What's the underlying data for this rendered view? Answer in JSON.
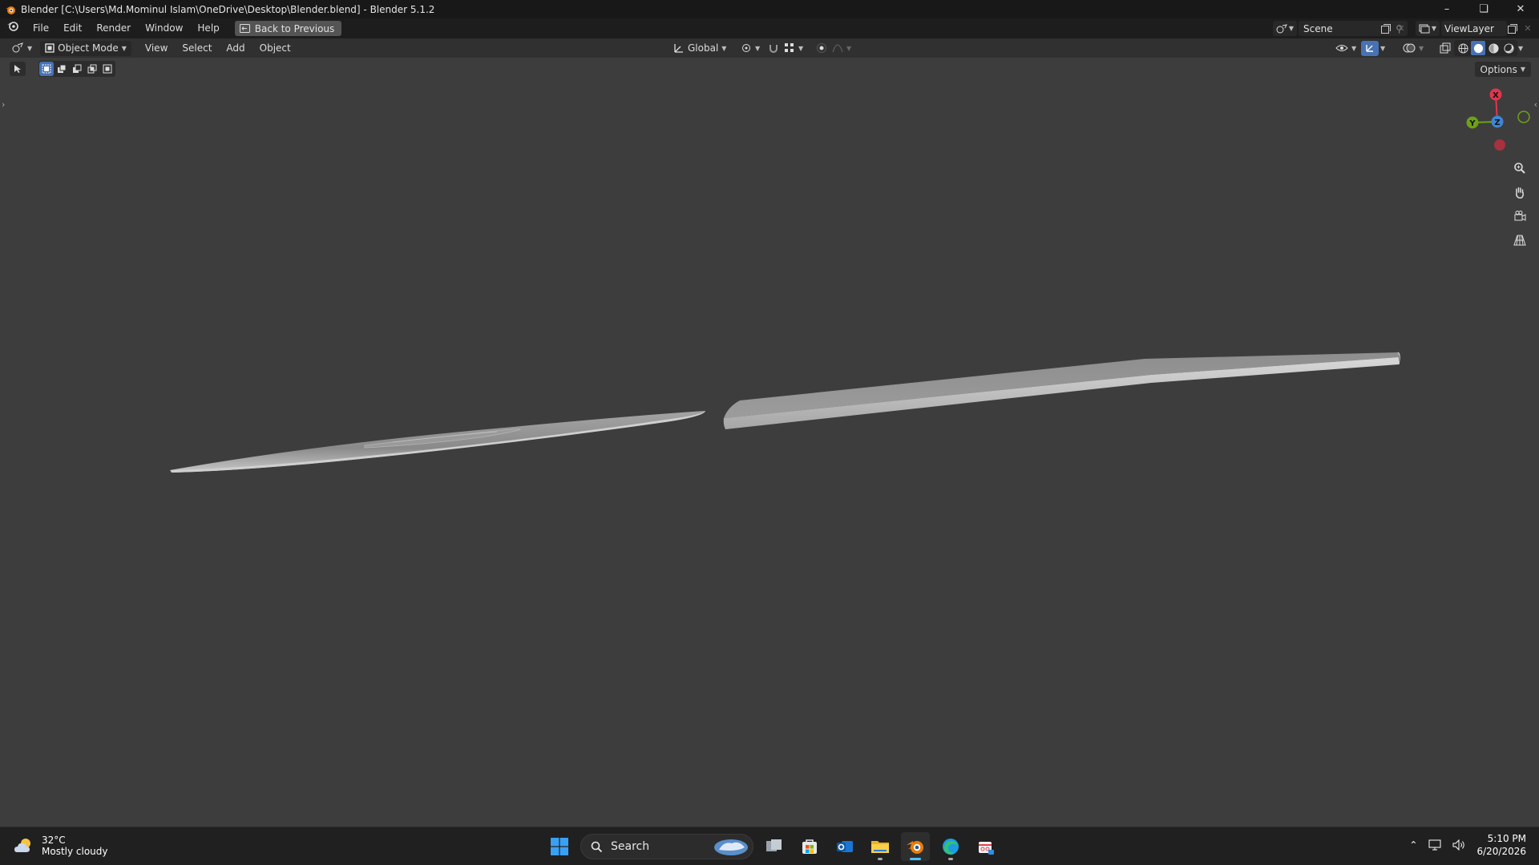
{
  "window": {
    "title": "Blender [C:\\Users\\Md.Mominul Islam\\OneDrive\\Desktop\\Blender.blend] - Blender 5.1.2",
    "controls": [
      "minimize-icon",
      "restore-icon",
      "close-icon"
    ]
  },
  "menubar": {
    "items": [
      "File",
      "Edit",
      "Render",
      "Window",
      "Help"
    ],
    "back_button": "Back to Previous",
    "scene": "Scene",
    "view_layer": "ViewLayer"
  },
  "viewport_header": {
    "mode": "Object Mode",
    "menus": [
      "View",
      "Select",
      "Add",
      "Object"
    ],
    "transform_orientation": "Global",
    "options": "Options"
  },
  "gizmo": {
    "x_color": "#e0364e",
    "y_color": "#6ea117",
    "z_color": "#3e86d6",
    "labels": {
      "x": "X",
      "y": "Y",
      "z": "Z"
    }
  },
  "taskbar": {
    "weather_temp": "32°C",
    "weather_desc": "Mostly cloudy",
    "search_placeholder": "Search",
    "time": "5:10 PM",
    "date": "6/20/2026"
  }
}
